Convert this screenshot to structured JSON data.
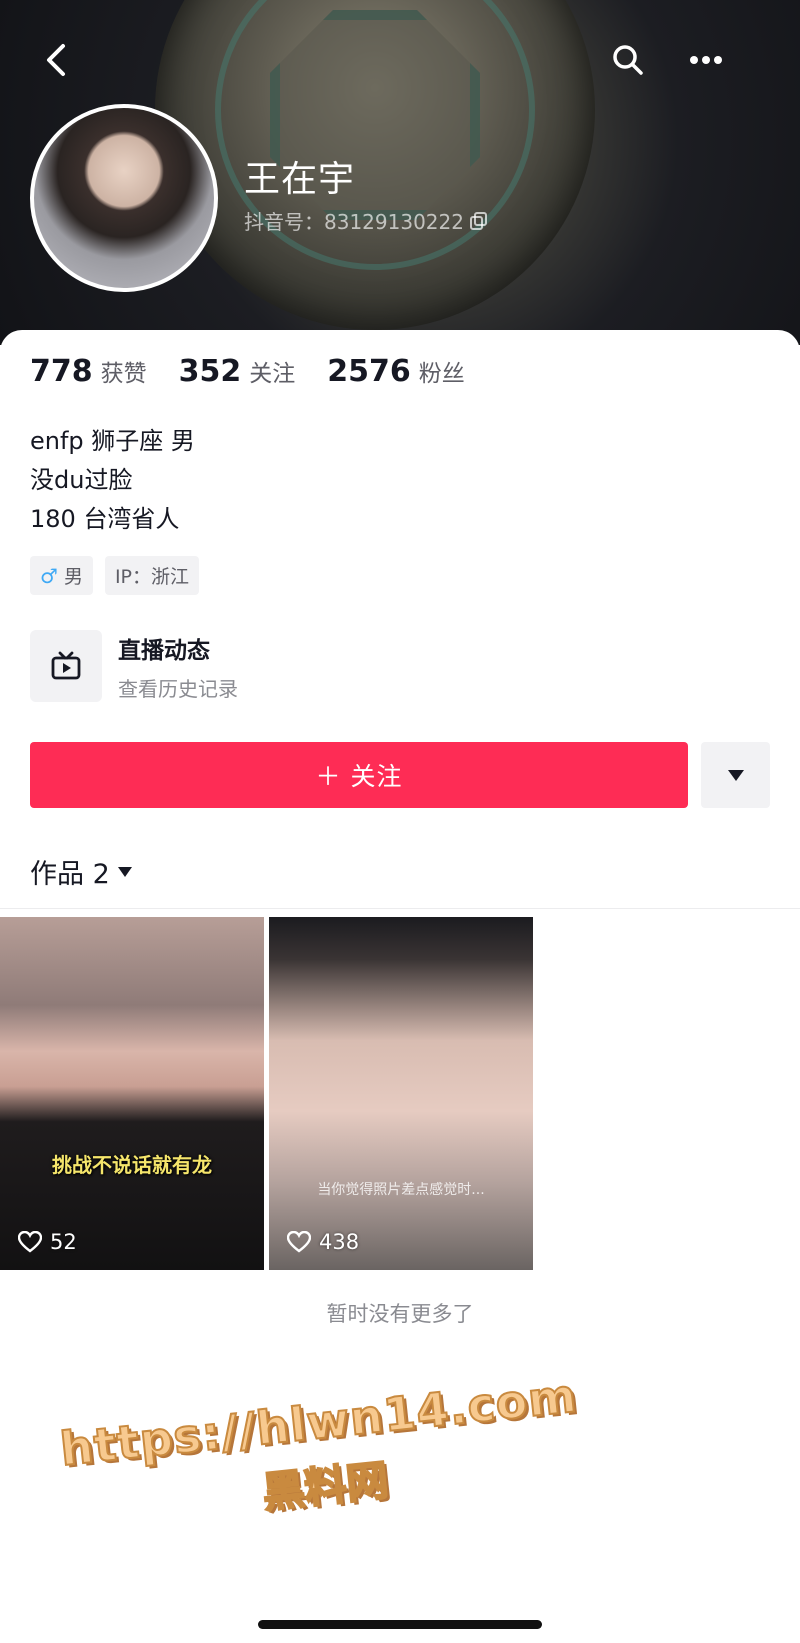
{
  "header": {
    "back_icon": "chevron-left-icon",
    "search_icon": "search-icon",
    "more_icon": "ellipsis-icon",
    "username": "王在宇",
    "douyin_id": "抖音号：83129130222",
    "copy_icon": "copy-icon"
  },
  "stats": [
    {
      "value": "778",
      "label": "获赞"
    },
    {
      "value": "352",
      "label": "关注"
    },
    {
      "value": "2576",
      "label": "粉丝"
    }
  ],
  "bio": {
    "lines": [
      "enfp 狮子座 男",
      "没du过脸",
      "180 台湾省人"
    ]
  },
  "tags": {
    "gender_symbol": "♂",
    "gender": "男",
    "ip": "IP：浙江"
  },
  "live": {
    "icon": "tv-icon",
    "title": "直播动态",
    "subtitle": "查看历史记录"
  },
  "actions": {
    "follow_label": "＋ 关注",
    "more_icon": "triangle-down-icon"
  },
  "works": {
    "tab_label": "作品 2",
    "items": [
      {
        "caption": "挑战不说话就有龙",
        "likes": "52"
      },
      {
        "caption": "当你觉得照片差点感觉时...",
        "likes": "438"
      }
    ],
    "end_text": "暂时没有更多了"
  },
  "watermark": {
    "url": "https://hlwn14.com",
    "name": "黑料网"
  },
  "colors": {
    "accent": "#fe2c55",
    "text": "#161823",
    "secondary": "#8a8b91"
  }
}
